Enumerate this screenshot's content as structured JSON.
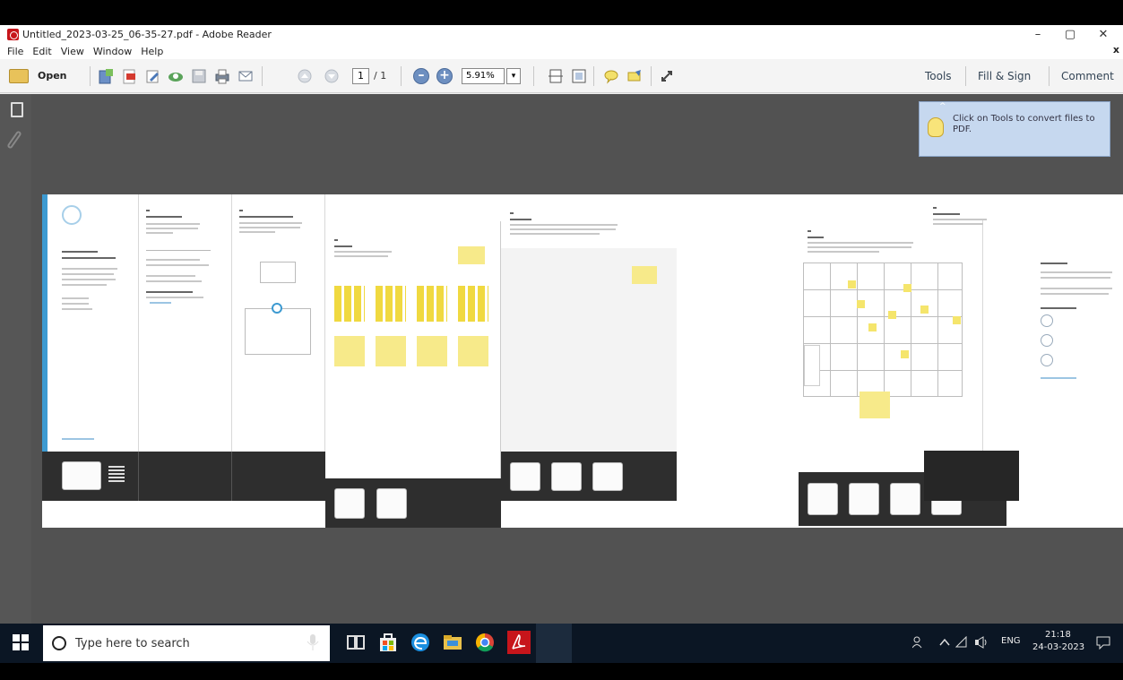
{
  "window": {
    "title": "Untitled_2023-03-25_06-35-27.pdf - Adobe Reader",
    "minimize": "–",
    "maximize": "▢",
    "close": "✕"
  },
  "menu": {
    "items": [
      "File",
      "Edit",
      "View",
      "Window",
      "Help"
    ],
    "close_doc": "x"
  },
  "toolbar": {
    "open_label": "Open",
    "page_current": "1",
    "page_total": "/ 1",
    "zoom_value": "5.91%",
    "zoom_dropdown": "▾",
    "zoom_out": "–",
    "zoom_in": "+",
    "right_links": [
      "Tools",
      "Fill & Sign",
      "Comment"
    ]
  },
  "tooltip": {
    "text": "Click on Tools to convert files to PDF.",
    "caret": "^"
  },
  "taskbar": {
    "search_placeholder": "Type here to search",
    "lang": "ENG",
    "time": "21:18",
    "date": "24-03-2023"
  },
  "colors": {
    "accent_blue": "#3d9ad1",
    "sticky_yellow": "#f5e56c",
    "doc_bg": "#525252",
    "taskbar": "#0b1624"
  }
}
